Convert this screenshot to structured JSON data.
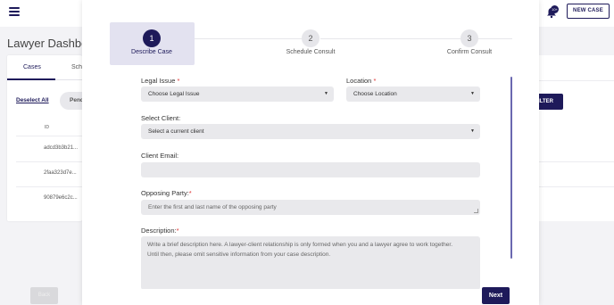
{
  "header": {
    "new_case_label": "NEW CASE",
    "notification_count": "10+",
    "close_glyph": "×"
  },
  "dashboard": {
    "title": "Lawyer Dashboard",
    "tabs": [
      {
        "label": "Cases"
      },
      {
        "label": "Sche"
      }
    ],
    "deselect_all": "Deselect All",
    "pending_pill": "Pend",
    "column_header": "ID",
    "rows": [
      {
        "id": "adcd3b3b21..."
      },
      {
        "id": "2faa323d7e..."
      },
      {
        "id": "90879e6c2c..."
      }
    ],
    "filter_label": "FILTER"
  },
  "wizard": {
    "steps": [
      {
        "number": "1",
        "label": "Describe Case",
        "active": true
      },
      {
        "number": "2",
        "label": "Schedule Consult",
        "active": false
      },
      {
        "number": "3",
        "label": "Confirm Consult",
        "active": false
      }
    ],
    "form": {
      "legal_issue": {
        "label": "Legal Issue",
        "value": "Choose Legal Issue"
      },
      "location": {
        "label": "Location",
        "value": "Choose Location"
      },
      "select_client": {
        "label": "Select Client:",
        "value": "Select a current client"
      },
      "client_email": {
        "label": "Client Email:",
        "value": ""
      },
      "opposing_party": {
        "label": "Opposing Party:",
        "placeholder": "Enter the first and last name of the opposing party"
      },
      "description": {
        "label": "Description:",
        "placeholder_line1": "Write a brief description here. A lawyer-client relationship is only formed when you and a lawyer agree to work together.",
        "placeholder_line2": "Until then, please omit sensitive information from your case description."
      }
    },
    "back_label": "Back",
    "next_label": "Next"
  },
  "colors": {
    "accent": "#1e1a5a",
    "active_step_bg": "#e3e2f0",
    "required": "#dd3333"
  },
  "icons": [
    "hamburger-menu-icon",
    "close-icon",
    "bell-icon",
    "chevron-down-icon"
  ]
}
